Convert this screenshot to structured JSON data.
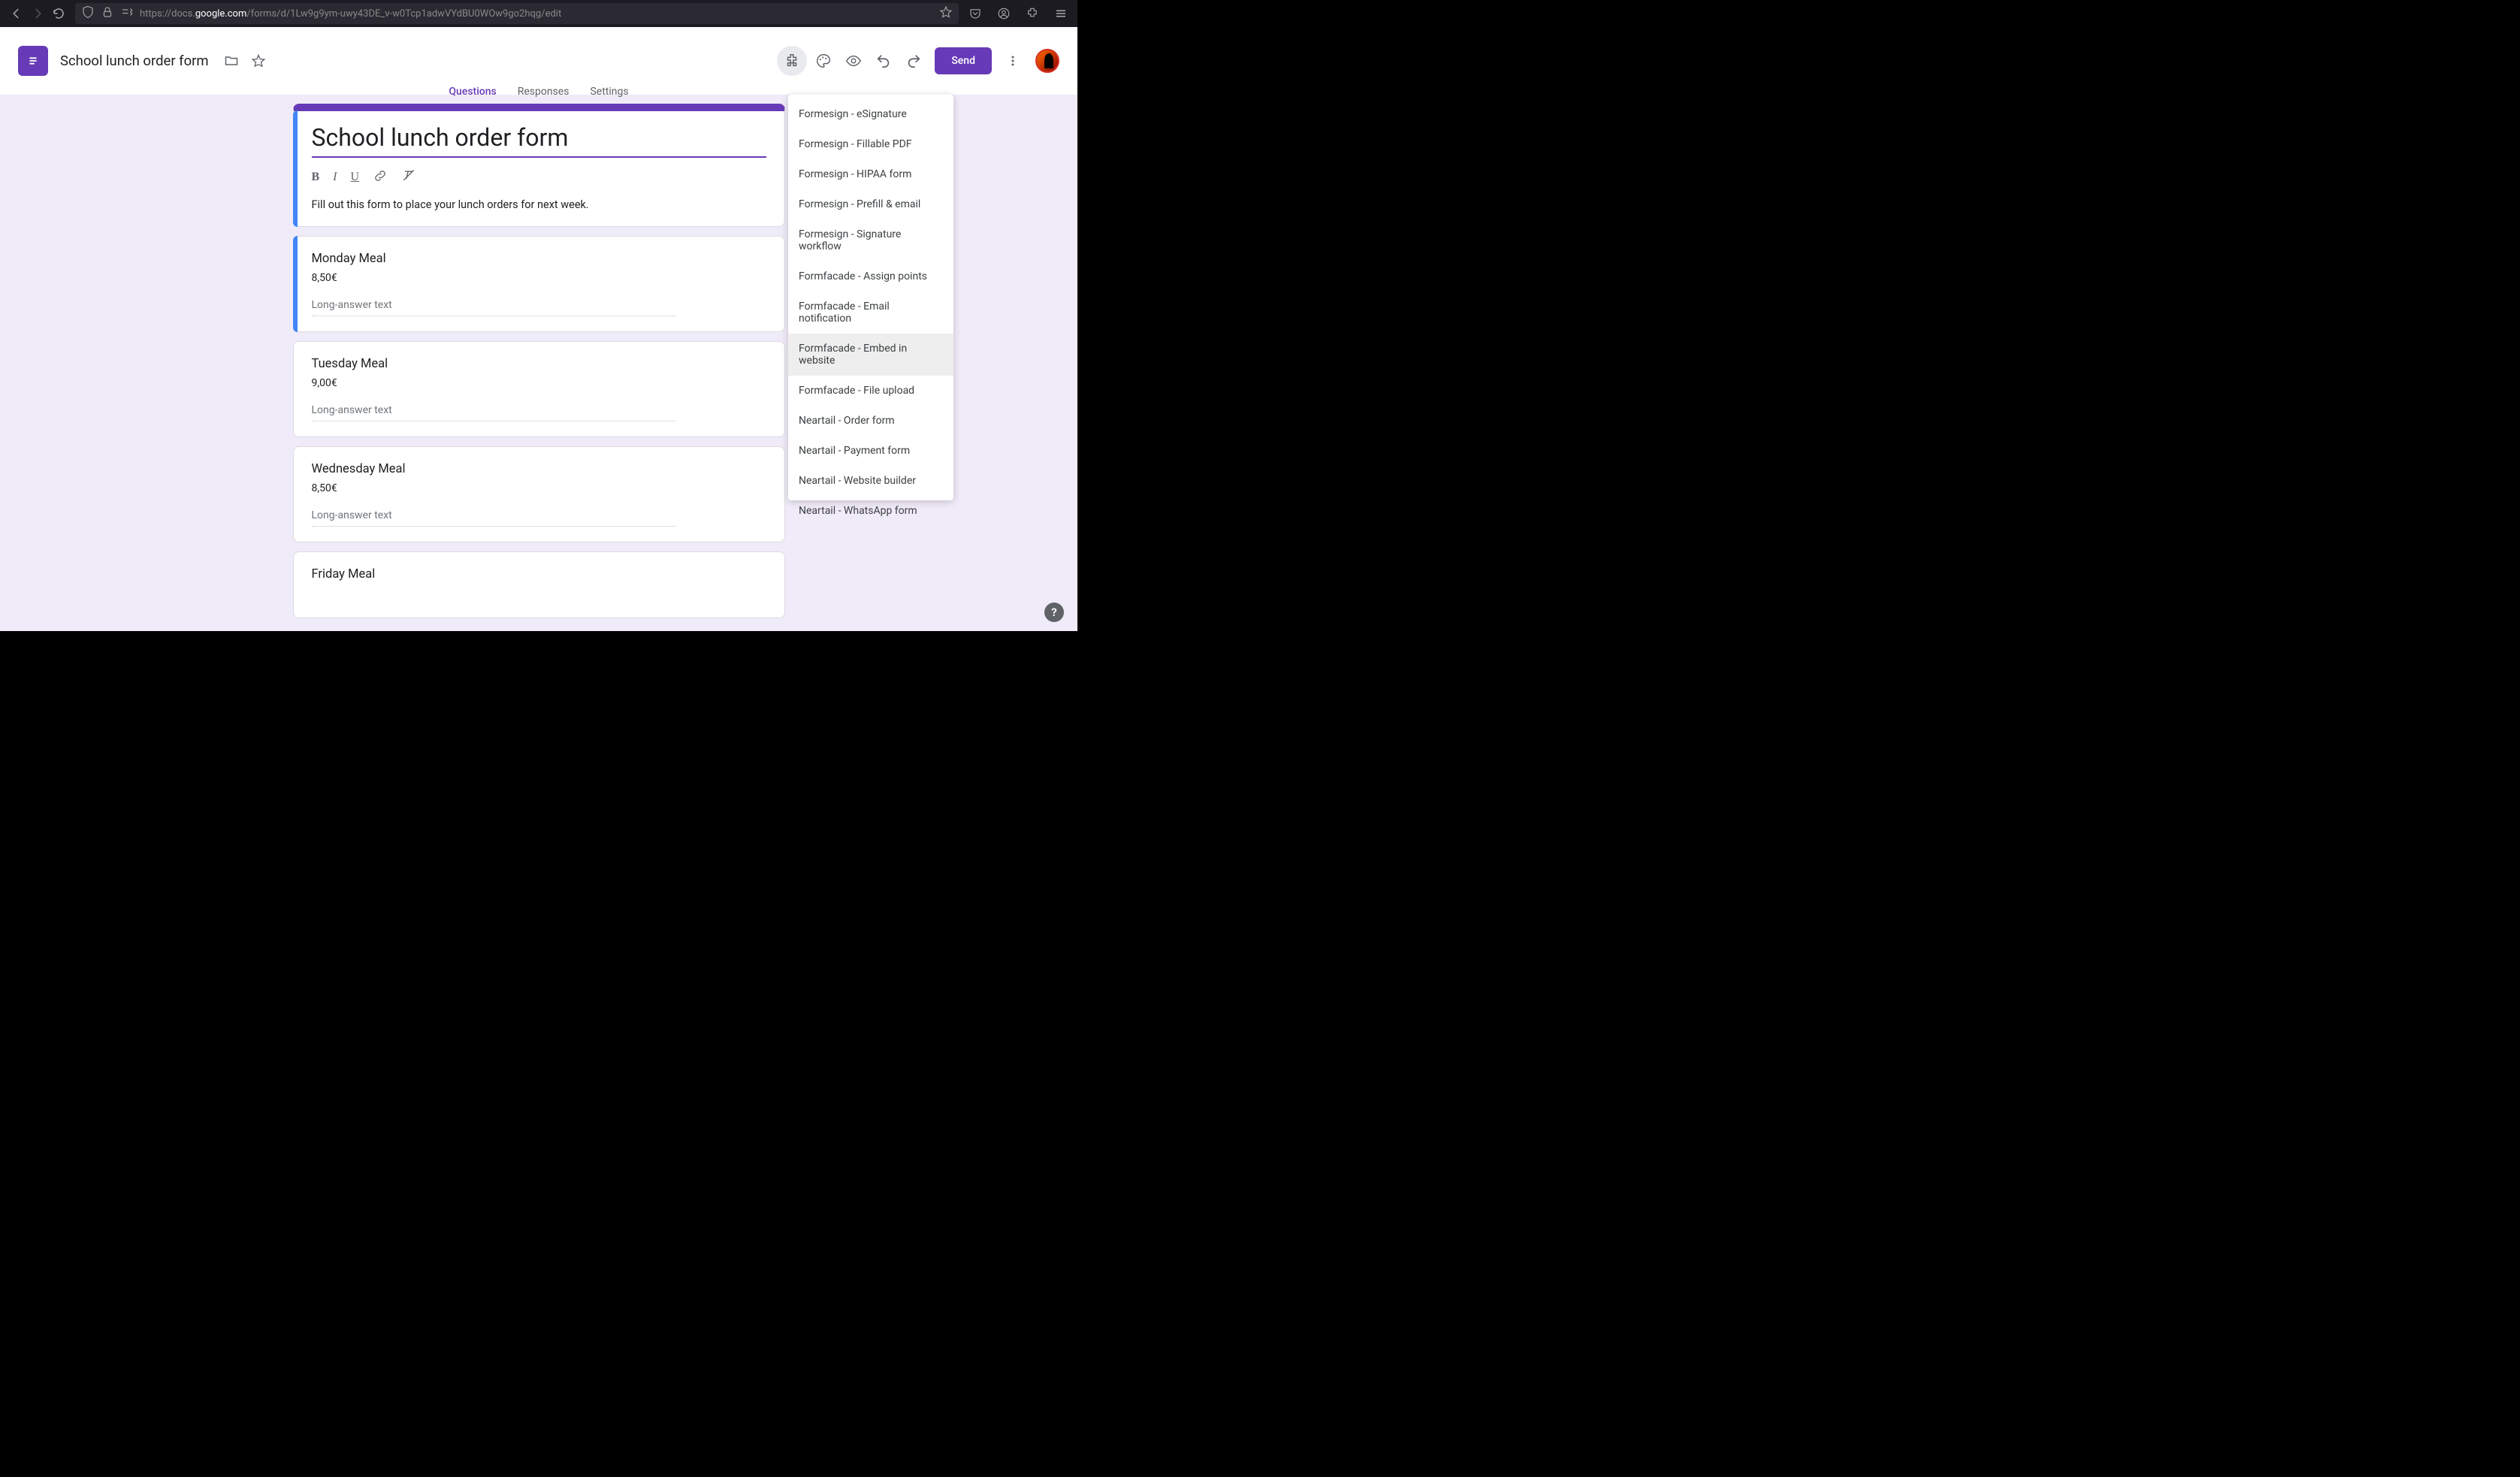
{
  "browser": {
    "url_prefix": "https://docs.",
    "url_bold": "google.com",
    "url_suffix": "/forms/d/1Lw9g9ym-uwy43DE_v-w0Tcp1adwVYdBU0WOw9go2hqg/edit"
  },
  "header": {
    "doc_title": "School lunch order form",
    "send_label": "Send"
  },
  "tabs": [
    {
      "label": "Questions",
      "active": true
    },
    {
      "label": "Responses",
      "active": false
    },
    {
      "label": "Settings",
      "active": false
    }
  ],
  "form": {
    "title": "School lunch order form",
    "description": "Fill out this form to place your lunch orders for next week.",
    "answer_placeholder": "Long-answer text",
    "questions": [
      {
        "title": "Monday Meal",
        "price": "8,50€",
        "selected": true
      },
      {
        "title": "Tuesday Meal",
        "price": "9,00€",
        "selected": false
      },
      {
        "title": "Wednesday Meal",
        "price": "8,50€",
        "selected": false
      },
      {
        "title": "Friday Meal",
        "price": "",
        "selected": false
      }
    ]
  },
  "addons": {
    "items": [
      "Formesign - eSignature",
      "Formesign - Fillable PDF",
      "Formesign - HIPAA form",
      "Formesign - Prefill & email",
      "Formesign - Signature workflow",
      "Formfacade - Assign points",
      "Formfacade - Email notification",
      "Formfacade - Embed in website",
      "Formfacade - File upload",
      "Neartail - Order form",
      "Neartail - Payment form",
      "Neartail - Website builder",
      "Neartail - WhatsApp form"
    ],
    "highlighted_index": 7
  }
}
